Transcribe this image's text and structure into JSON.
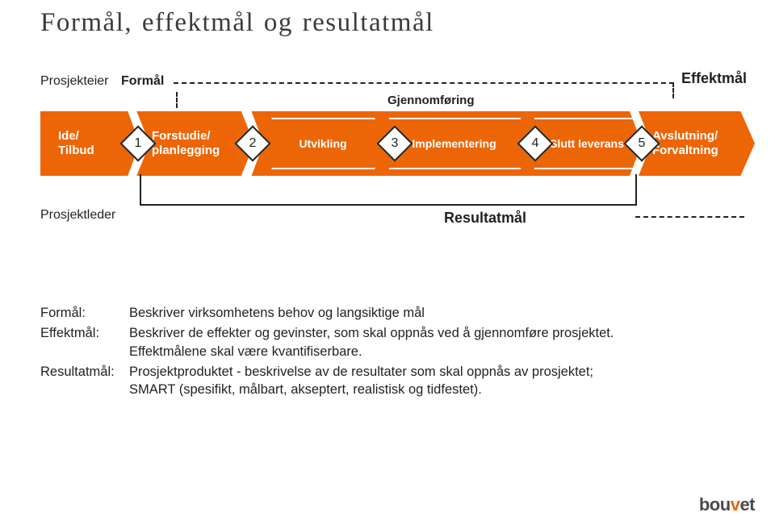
{
  "page_title": "Formål, effektmål og resultatmål",
  "owner": {
    "role": "Prosjekteier",
    "goal_type_start": "Formål",
    "goal_type_end": "Effektmål"
  },
  "leader": {
    "role": "Prosjektleder",
    "goal_type": "Resultatmål"
  },
  "process": {
    "phase1": {
      "line1": "Ide/",
      "line2": "Tilbud"
    },
    "phase2": {
      "line1": "Forstudie/",
      "line2": "planlegging"
    },
    "phase3_header": "Gjennomføring",
    "phase3a": "Utvikling",
    "phase3b": "Implementering",
    "phase4": "Slutt leverans",
    "phase5": {
      "line1": "Avslutning/",
      "line2": "Forvaltning"
    },
    "milestones": {
      "m1": "1",
      "m2": "2",
      "m3": "3",
      "m4": "4",
      "m5": "5"
    }
  },
  "definitions": {
    "formal": {
      "term": "Formål:",
      "text": "Beskriver virksomhetens behov og langsiktige mål"
    },
    "effekt": {
      "term": "Effektmål:",
      "text1": "Beskriver de effekter og gevinster, som skal oppnås ved å gjennomføre prosjektet.",
      "text2": "Effektmålene skal være kvantifiserbare."
    },
    "resultat": {
      "term": "Resultatmål:",
      "text1": "Prosjektproduktet - beskrivelse av de resultater som skal oppnås av prosjektet;",
      "text2": "SMART (spesifikt, målbart, akseptert, realistisk og tidfestet)."
    }
  },
  "logo": {
    "part1": "bou",
    "part2": "v",
    "part3": "et"
  }
}
